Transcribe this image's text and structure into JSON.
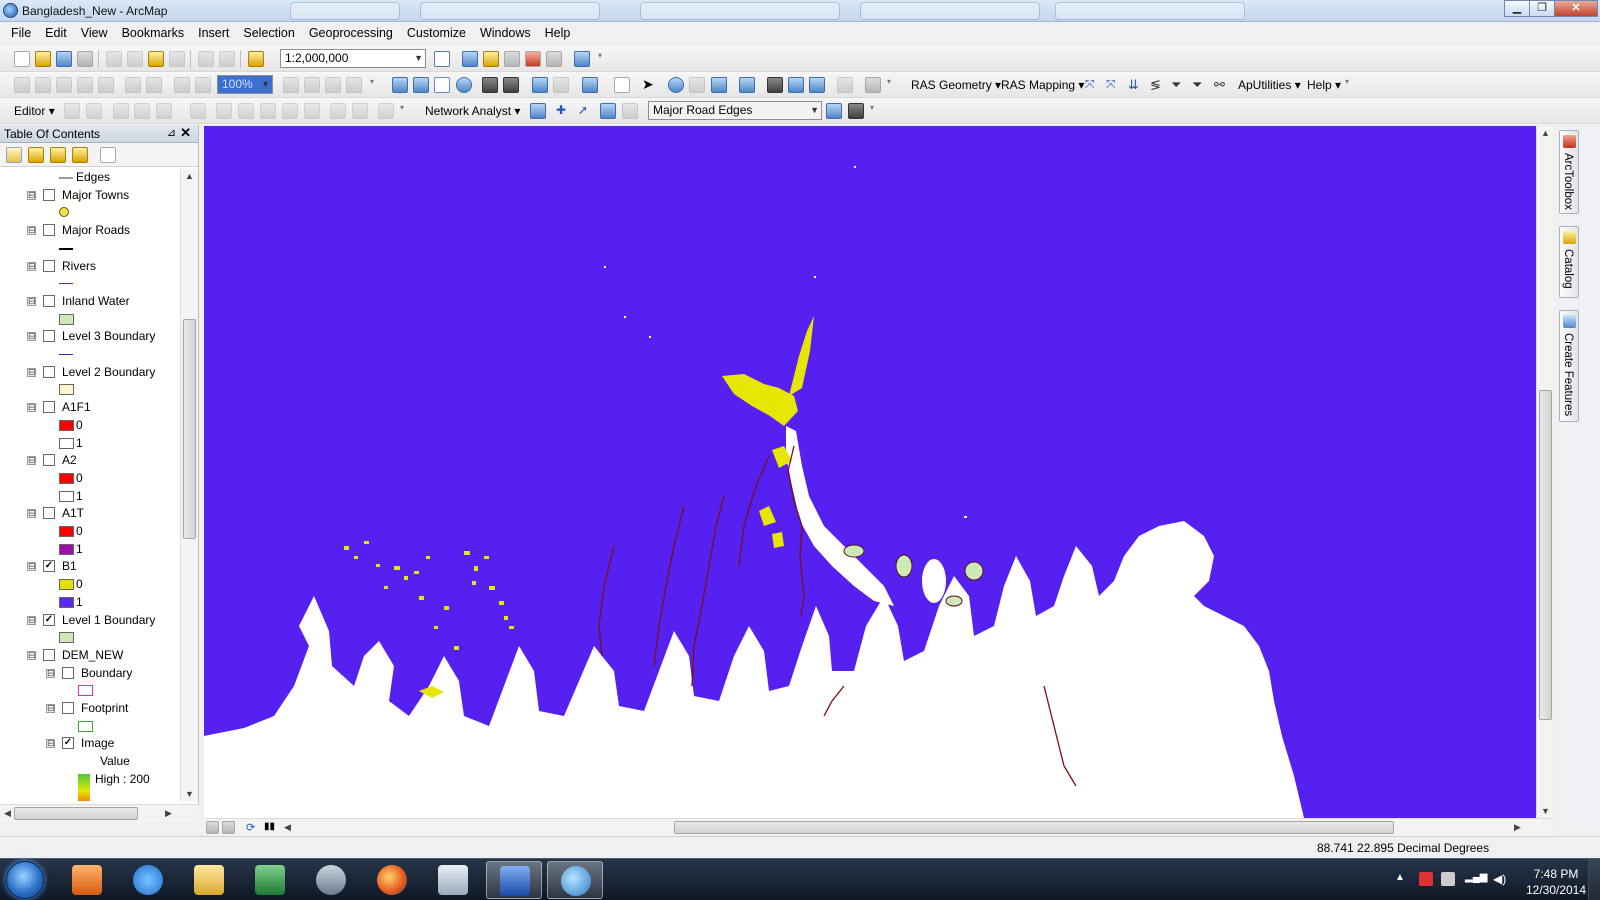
{
  "window": {
    "title": "Bangladesh_New - ArcMap",
    "controls": {
      "minimize": "▁",
      "maximize": "❐",
      "close": "✕"
    }
  },
  "menu": [
    "File",
    "Edit",
    "View",
    "Bookmarks",
    "Insert",
    "Selection",
    "Geoprocessing",
    "Customize",
    "Windows",
    "Help"
  ],
  "toolbar_standard": {
    "scale": "1:2,000,000"
  },
  "toolbar_tools": {
    "zoom_level": "100%",
    "hec_menus": [
      "RAS Geometry",
      "RAS Mapping"
    ],
    "ap_utilities": "ApUtilities",
    "help": "Help"
  },
  "toolbar_editor": {
    "editor": "Editor",
    "network_analyst": "Network Analyst",
    "layer_select": "Major Road Edges"
  },
  "toc": {
    "title": "Table Of Contents",
    "pin": "⊿",
    "close": "✕",
    "layers": [
      {
        "type": "sublabel",
        "label": "Edges"
      },
      {
        "type": "layer",
        "label": "Major Towns",
        "checked": false,
        "expand": "⊟"
      },
      {
        "type": "symbol",
        "symbol": "town"
      },
      {
        "type": "layer",
        "label": "Major Roads",
        "checked": false,
        "expand": "⊟"
      },
      {
        "type": "symbol",
        "symbol": "road"
      },
      {
        "type": "layer",
        "label": "Rivers",
        "checked": false,
        "expand": "⊟"
      },
      {
        "type": "symbol",
        "symbol": "river"
      },
      {
        "type": "layer",
        "label": "Inland Water",
        "checked": false,
        "expand": "⊟"
      },
      {
        "type": "symbol",
        "symbol": "inland-water"
      },
      {
        "type": "layer",
        "label": "Level 3 Boundary",
        "checked": false,
        "expand": "⊟"
      },
      {
        "type": "symbol",
        "symbol": "level3"
      },
      {
        "type": "layer",
        "label": "Level 2 Boundary",
        "checked": false,
        "expand": "⊟"
      },
      {
        "type": "symbol",
        "symbol": "level2"
      },
      {
        "type": "layer",
        "label": "A1F1",
        "checked": false,
        "expand": "⊟"
      },
      {
        "type": "class",
        "color": "#ff0000",
        "label": "0"
      },
      {
        "type": "class",
        "color": "#ffffff",
        "label": "1"
      },
      {
        "type": "layer",
        "label": "A2",
        "checked": false,
        "expand": "⊟"
      },
      {
        "type": "class",
        "color": "#ff0000",
        "label": "0"
      },
      {
        "type": "class",
        "color": "#ffffff",
        "label": "1"
      },
      {
        "type": "layer",
        "label": "A1T",
        "checked": false,
        "expand": "⊟"
      },
      {
        "type": "class",
        "color": "#ff0000",
        "label": "0"
      },
      {
        "type": "class",
        "color": "#9a10a8",
        "label": "1"
      },
      {
        "type": "layer",
        "label": "B1",
        "checked": true,
        "expand": "⊟"
      },
      {
        "type": "class",
        "color": "#e2e200",
        "label": "0"
      },
      {
        "type": "class",
        "color": "#5a28f0",
        "label": "1"
      },
      {
        "type": "layer",
        "label": "Level 1 Boundary",
        "checked": true,
        "expand": "⊟"
      },
      {
        "type": "symbol",
        "symbol": "level1"
      },
      {
        "type": "layer",
        "label": "DEM_NEW",
        "checked": false,
        "expand": "⊟"
      },
      {
        "type": "sublayer",
        "label": "Boundary",
        "checked": false
      },
      {
        "type": "symbol2",
        "symbol": "boundary"
      },
      {
        "type": "sublayer",
        "label": "Footprint",
        "checked": false
      },
      {
        "type": "symbol2",
        "symbol": "footprint"
      },
      {
        "type": "sublayer",
        "label": "Image",
        "checked": true
      },
      {
        "type": "legend-title",
        "label": "Value"
      },
      {
        "type": "legend-high",
        "label": "High : 200"
      }
    ]
  },
  "colors": {
    "flood_class_1": "#5620f0",
    "flood_class_0": "#e6e600",
    "land": "#ffffff",
    "boundary_line": "#7a1010"
  },
  "dock_tabs": [
    "ArcToolbox",
    "Catalog",
    "Create Features"
  ],
  "status": {
    "coordinates": "88.741  22.895 Decimal Degrees"
  },
  "taskbar": {
    "apps": [
      "media-player",
      "internet-explorer",
      "file-explorer",
      "excel",
      "network-app",
      "firefox",
      "calculator",
      "word",
      "arcmap"
    ],
    "time": "7:48 PM",
    "date": "12/30/2014"
  }
}
